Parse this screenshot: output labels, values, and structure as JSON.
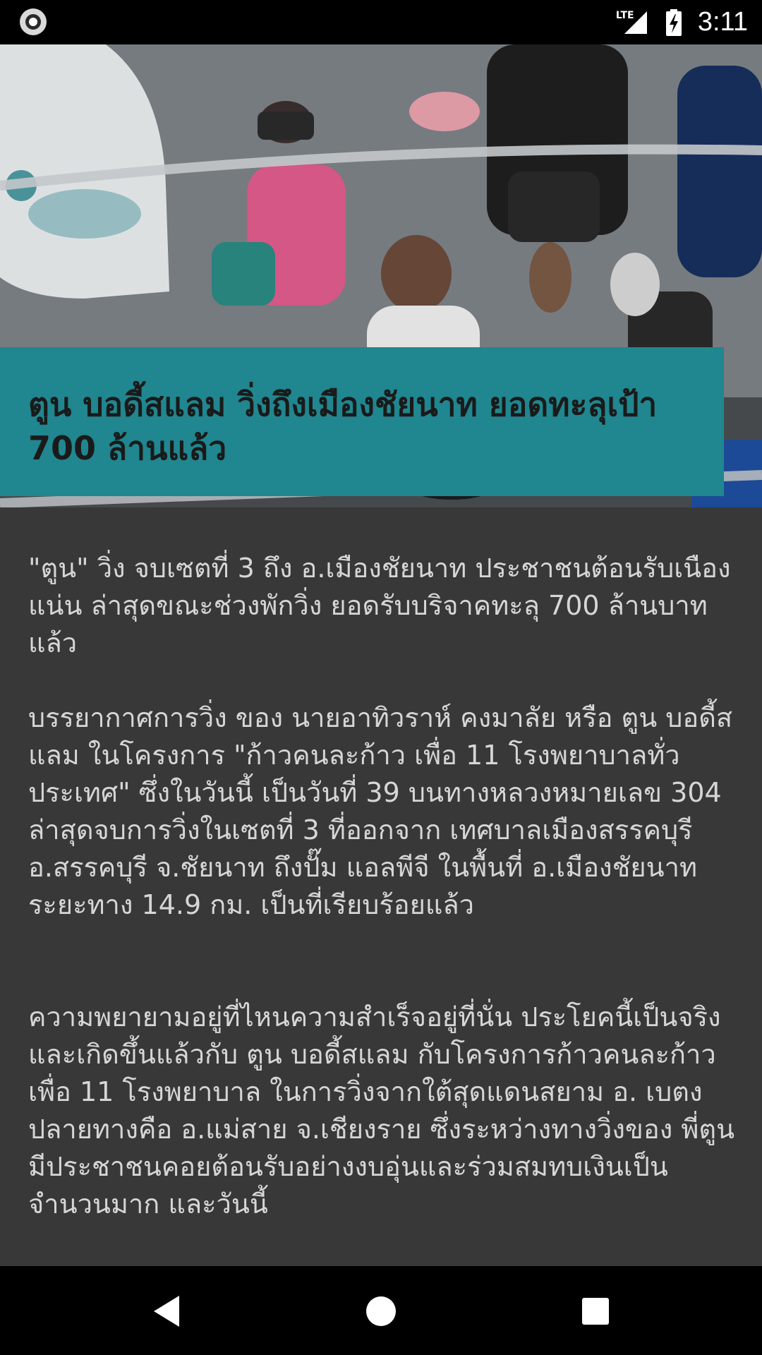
{
  "status_bar": {
    "time": "3:11",
    "network_label": "LTE",
    "icons": [
      "app-notification-icon",
      "lte-signal-icon",
      "battery-charging-icon"
    ]
  },
  "hero": {
    "image": "runners-photo"
  },
  "article": {
    "title": "ตูน บอดี้สแลม วิ่งถึงเมืองชัยนาท ยอดทะลุเป้า 700 ล้านแล้ว",
    "paragraphs": [
      "\"ตูน\" วิ่ง จบเซตที่ 3 ถึง อ.เมืองชัยนาท ประชาชนต้อนรับเนืองแน่น ล่าสุดขณะช่วงพักวิ่ง ยอดรับบริจาคทะลุ 700 ล้านบาทแล้ว",
      "บรรยากาศการวิ่ง ของ นายอาทิวราห์ คงมาลัย หรือ ตูน บอดี้สแลม ในโครงการ \"ก้าวคนละก้าว เพื่อ 11 โรงพยาบาลทั่วประเทศ\" ซึ่งในวันนี้ เป็นวันที่ 39 บนทางหลวงหมายเลข 304 ล่าสุดจบการวิ่งในเซตที่ 3 ที่ออกจาก เทศบาลเมืองสรรคบุรี อ.สรรคบุรี จ.ชัยนาท ถึงปั๊ม แอลพีจี ในพื้นที่ อ.เมืองชัยนาท ระยะทาง 14.9 กม. เป็นที่เรียบร้อยแล้ว",
      "ความพยายามอยู่ที่ไหนความสำเร็จอยู่ที่นั่น ประโยคนี้เป็นจริงและเกิดขึ้นแล้วกับ ตูน บอดี้สแลม กับโครงการก้าวคนละก้าวเพื่อ 11 โรงพยาบาล ในการวิ่งจากใต้สุดแดนสยาม อ. เบตง ปลายทางคือ อ.แม่สาย จ.เชียงราย ซึ่งระหว่างทางวิ่งของ พี่ตูน มีประชาชนคอยต้อนรับอย่างงบอุ่นและร่วมสมทบเงินเป็นจำนวนมาก และวันนี้"
    ]
  },
  "nav_bar": {
    "buttons": [
      "back",
      "home",
      "recents"
    ]
  }
}
